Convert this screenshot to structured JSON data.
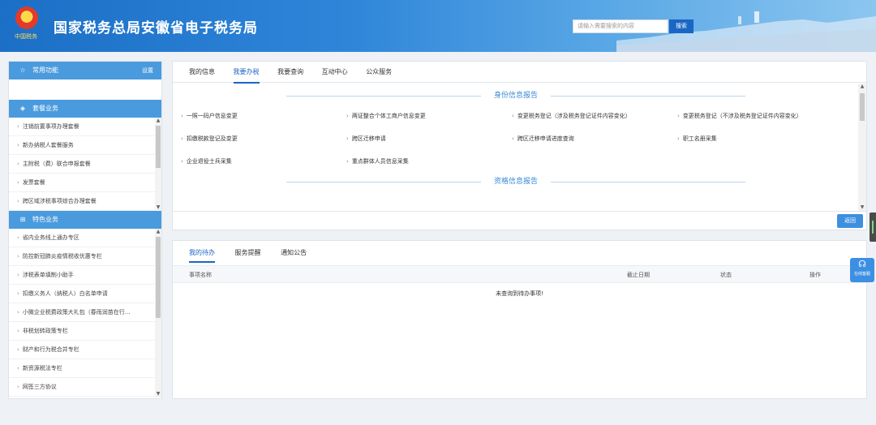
{
  "header": {
    "title": "国家税务总局安徽省电子税务局",
    "motto": "中国税务",
    "search_placeholder": "请输入需要搜索的内容",
    "search_button": "搜索"
  },
  "sidebar": {
    "common": {
      "label": "常用功能",
      "settings": "设置",
      "icon": "star-icon"
    },
    "package": {
      "label": "套餐业务",
      "icon": "layers-icon",
      "items": [
        "注销前置事项办理套餐",
        "新办纳税人套餐服务",
        "主附税（费）联合申报套餐",
        "发票套餐",
        "跨区域涉税事项综合办理套餐"
      ]
    },
    "special": {
      "label": "特色业务",
      "icon": "grid-icon",
      "items": [
        "省内业务线上通办专区",
        "防控新冠肺炎疫情税收优惠专栏",
        "涉税表单填制小助手",
        "扣缴义务人（纳税人）白名单申请",
        "小微企业税费政策大礼包（春雨润苗在行...",
        "非税划转政策专栏",
        "财产和行为税合并专栏",
        "新资源税法专栏",
        "网签三方协议"
      ]
    }
  },
  "main_tabs": [
    "我的信息",
    "我要办税",
    "我要查询",
    "互动中心",
    "公众服务"
  ],
  "main_active_tab": "我要办税",
  "sections": {
    "identity": {
      "title": "身份信息报告",
      "reports": [
        "一照一码户信息变更",
        "两证整合个体工商户信息变更",
        "变更税务登记（涉及税务登记证件内容变化）",
        "变更税务登记（不涉及税务登记证件内容变化）",
        "扣缴税款登记及变更",
        "跨区迁移申请",
        "跨区迁移申请进度查询",
        "职工名册采集",
        "企业退役士兵采集",
        "重点群体人员信息采集"
      ]
    },
    "qualification": {
      "title": "资格信息报告"
    }
  },
  "back_button": "返回",
  "todo": {
    "tabs": [
      "我的待办",
      "服务提醒",
      "通知公告"
    ],
    "active_tab": "我的待办",
    "columns": [
      "事项名称",
      "截止日期",
      "状态",
      "操作"
    ],
    "empty_message": "未查询到待办事项!"
  },
  "service_widget": {
    "label": "在线客服",
    "icon": "headset-icon"
  }
}
